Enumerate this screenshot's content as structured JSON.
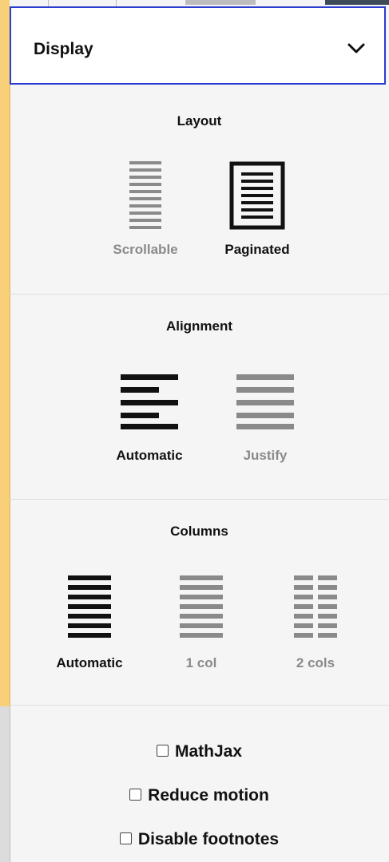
{
  "panel": {
    "title": "Display"
  },
  "layout": {
    "title": "Layout",
    "options": [
      {
        "label": "Scrollable",
        "selected": false
      },
      {
        "label": "Paginated",
        "selected": true
      }
    ]
  },
  "alignment": {
    "title": "Alignment",
    "options": [
      {
        "label": "Automatic",
        "selected": true
      },
      {
        "label": "Justify",
        "selected": false
      }
    ]
  },
  "columns": {
    "title": "Columns",
    "options": [
      {
        "label": "Automatic",
        "selected": true
      },
      {
        "label": "1 col",
        "selected": false
      },
      {
        "label": "2 cols",
        "selected": false
      }
    ]
  },
  "toggles": [
    {
      "label": "MathJax",
      "checked": false
    },
    {
      "label": "Reduce motion",
      "checked": false
    },
    {
      "label": "Disable footnotes",
      "checked": false
    }
  ],
  "colors": {
    "active": "#111111",
    "inactive": "#8a8a8a",
    "focus_border": "#2a3bd0"
  }
}
